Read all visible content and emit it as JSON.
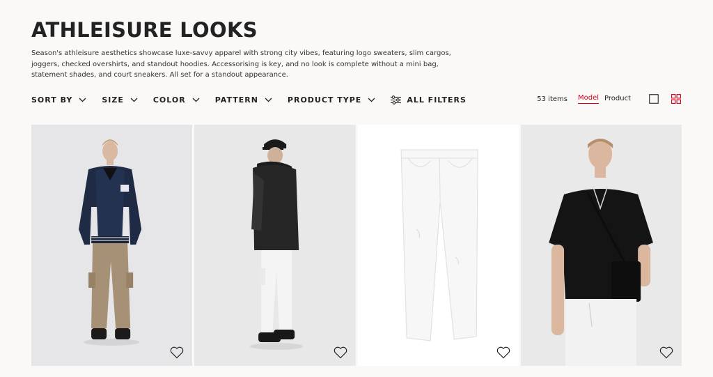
{
  "page": {
    "title": "ATHLEISURE LOOKS",
    "description": "Season's athleisure aesthetics showcase luxe-savvy apparel with strong city vibes, featuring logo sweaters, slim cargos, joggers, checked overshirts, and standout hoodies. Accessorising is key, and no look is complete without a mini bag, statement shades, and court sneakers. All set for a standout appearance."
  },
  "filters": {
    "sort_by": "SORT BY",
    "size": "SIZE",
    "color": "COLOR",
    "pattern": "PATTERN",
    "product_type": "PRODUCT TYPE",
    "all_filters": "ALL FILTERS"
  },
  "toolbar": {
    "count": "53 items",
    "model_label": "Model",
    "product_label": "Product",
    "active_view": "Model"
  },
  "colors": {
    "accent": "#d6001c",
    "background": "#faf9f8",
    "text": "#222222"
  },
  "products": [
    {
      "image": "model in navy varsity bomber jacket and beige cargo pants",
      "icon": "heart-icon"
    },
    {
      "image": "model in black leather jacket, black cap and white cargo pants",
      "icon": "heart-icon"
    },
    {
      "image": "white jeans flat lay",
      "icon": "heart-icon"
    },
    {
      "image": "model in black polo shirt with black crossbody bag",
      "icon": "heart-icon"
    }
  ]
}
